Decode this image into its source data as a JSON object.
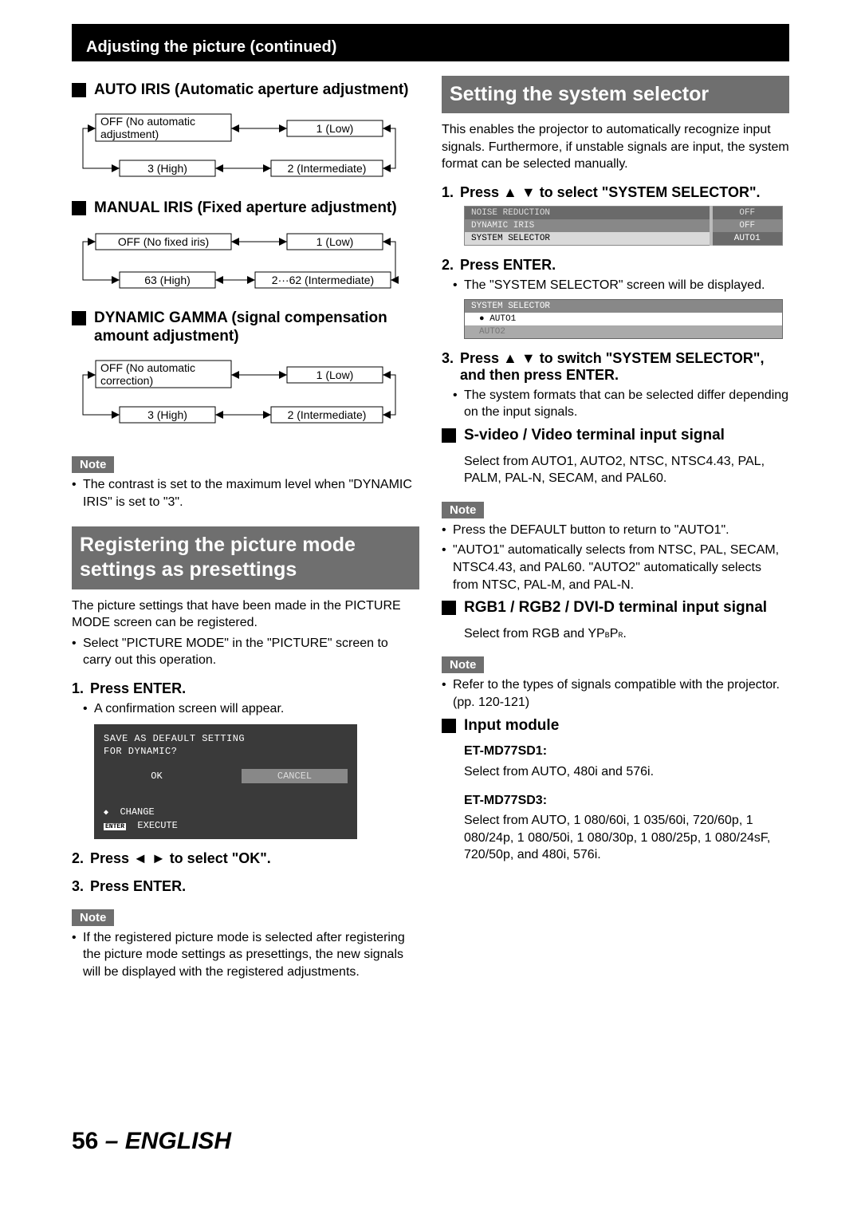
{
  "page": {
    "number": "56",
    "lang": "ENGLISH",
    "sep": " – "
  },
  "header": {
    "title": "Adjusting the picture (continued)"
  },
  "left": {
    "autoIris": {
      "heading": "AUTO IRIS (Automatic aperture adjustment)",
      "box1": {
        "line1": "OFF (No automatic",
        "line2": "adjustment)"
      },
      "box2": "1 (Low)",
      "box3": "3 (High)",
      "box4": "2 (Intermediate)"
    },
    "manualIris": {
      "heading": "MANUAL IRIS (Fixed aperture adjustment)",
      "box1": "OFF (No fixed iris)",
      "box2": "1 (Low)",
      "box3": "63 (High)",
      "box4": "2···62 (Intermediate)"
    },
    "dynGamma": {
      "heading": "DYNAMIC GAMMA (signal compensation amount adjustment)",
      "box1": {
        "line1": "OFF (No automatic",
        "line2": "correction)"
      },
      "box2": "1 (Low)",
      "box3": "3 (High)",
      "box4": "2 (Intermediate)"
    },
    "note1": {
      "label": "Note",
      "text": "The contrast is set to the maximum level when \"DYNAMIC IRIS\" is set to \"3\"."
    },
    "register": {
      "bar": "Registering the picture mode settings as presettings",
      "intro": "The picture settings that have been made in the PICTURE MODE screen can be registered.",
      "introBullet": "Select \"PICTURE MODE\" in the \"PICTURE\" screen to carry out this operation.",
      "step1": {
        "num": "1.",
        "text": "Press ENTER.",
        "sub": "A confirmation screen will appear."
      },
      "panel": {
        "line1": "SAVE AS DEFAULT SETTING",
        "line2": "FOR DYNAMIC?",
        "ok": "OK",
        "cancel": "CANCEL",
        "change": "CHANGE",
        "execute": "EXECUTE",
        "enter": "ENTER"
      },
      "step2": {
        "num": "2.",
        "text": "Press ◄ ► to select \"OK\"."
      },
      "step3": {
        "num": "3.",
        "text": "Press ENTER."
      },
      "note2": {
        "label": "Note",
        "text": "If the registered picture mode is selected after registering the picture mode settings as presettings, the new signals will be displayed with the registered adjustments."
      }
    }
  },
  "right": {
    "systemSelector": {
      "bar": "Setting the system selector",
      "intro": "This enables the projector to automatically recognize input signals. Furthermore, if unstable signals are input, the system format can be selected manually.",
      "step1": {
        "num": "1.",
        "text": "Press ▲ ▼ to select \"SYSTEM SELECTOR\"."
      },
      "menu": {
        "r1": {
          "label": "NOISE REDUCTION",
          "val": "OFF"
        },
        "r2": {
          "label": "DYNAMIC IRIS",
          "val": "OFF"
        },
        "r3": {
          "label": "SYSTEM SELECTOR",
          "val": "AUTO1"
        }
      },
      "step2": {
        "num": "2.",
        "text": "Press ENTER.",
        "sub": "The \"SYSTEM SELECTOR\" screen will be displayed."
      },
      "selPanel": {
        "hdr": "SYSTEM SELECTOR",
        "opt1": "● AUTO1",
        "opt2": "  AUTO2"
      },
      "step3": {
        "num": "3.",
        "text": "Press ▲ ▼ to switch \"SYSTEM SELECTOR\", and then press ENTER.",
        "sub": "The system formats that can be selected differ depending on the input signals."
      },
      "svideo": {
        "heading": "S-video / Video terminal input signal",
        "body": "Select from AUTO1, AUTO2, NTSC, NTSC4.43, PAL, PALM, PAL-N, SECAM, and PAL60.",
        "noteLabel": "Note",
        "notes": [
          "Press the DEFAULT button to return to \"AUTO1\".",
          "\"AUTO1\" automatically selects from NTSC, PAL, SECAM, NTSC4.43, and PAL60. \"AUTO2\" automatically selects from NTSC, PAL-M, and PAL-N."
        ]
      },
      "rgb": {
        "heading": "RGB1 / RGB2 / DVI-D terminal input signal",
        "body_pre": "Select from RGB and YP",
        "body_sub1": "B",
        "body_mid": "P",
        "body_sub2": "R",
        "body_post": ".",
        "noteLabel": "Note",
        "note": "Refer to the types of signals compatible with the projector. (pp. 120-121)"
      },
      "inputModule": {
        "heading": "Input module",
        "mod1": {
          "name": "ET-MD77SD1:",
          "body": "Select from AUTO, 480i and 576i."
        },
        "mod2": {
          "name": "ET-MD77SD3:",
          "body": "Select from AUTO, 1 080/60i, 1 035/60i, 720/60p, 1 080/24p, 1 080/50i, 1 080/30p, 1 080/25p, 1 080/24sF, 720/50p, and 480i, 576i."
        }
      }
    }
  }
}
